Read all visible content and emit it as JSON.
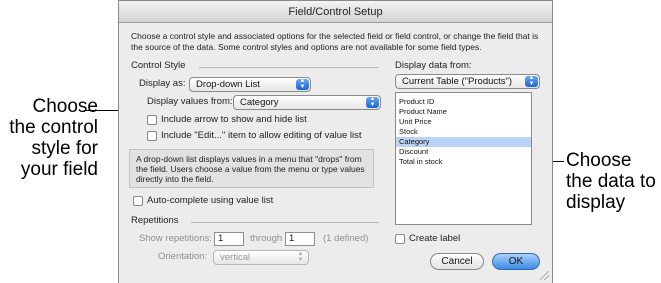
{
  "dialog": {
    "title": "Field/Control Setup",
    "intro": "Choose a control style and associated options for the selected field or field control, or change the field that is the source of the data. Some control styles and options are not available for some field types."
  },
  "control_style": {
    "heading": "Control Style",
    "display_as_label": "Display as:",
    "display_as_value": "Drop-down List",
    "values_from_label": "Display values from:",
    "values_from_value": "Category",
    "arrow_checkbox_label": "Include arrow to show and hide list",
    "arrow_checked": false,
    "edit_checkbox_label": "Include \"Edit...\" item to allow editing of value list",
    "edit_checked": false,
    "description": "A drop-down list displays values in a menu that \"drops\" from the field. Users choose a value from the menu or type values directly into the field.",
    "autocomplete_label": "Auto-complete using value list",
    "autocomplete_checked": false
  },
  "repetitions": {
    "heading": "Repetitions",
    "show_label": "Show repetitions:",
    "from_value": "1",
    "through_label": "through",
    "through_value": "1",
    "defined_note": "(1 defined)",
    "orientation_label": "Orientation:",
    "orientation_value": "vertical"
  },
  "display_data": {
    "label": "Display data from:",
    "table_value": "Current Table (\"Products\")",
    "fields": [
      "Product ID",
      "Product Name",
      "Unit Price",
      "Stock",
      "Category",
      "Discount",
      "Total in stock"
    ],
    "selected_field": "Category",
    "create_label_text": "Create label",
    "create_label_checked": false
  },
  "buttons": {
    "cancel": "Cancel",
    "ok": "OK"
  },
  "callouts": {
    "left": "Choose the control style for your field",
    "right": "Choose the data to display"
  },
  "colors": {
    "highlight_bar": "#0018f0",
    "selection": "#b8d3f5",
    "default_button": "#3c8ae6"
  }
}
